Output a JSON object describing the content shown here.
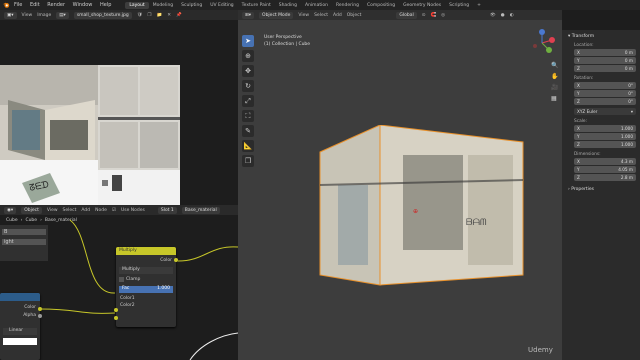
{
  "topbar": {
    "menus": [
      "File",
      "Edit",
      "Render",
      "Window",
      "Help"
    ],
    "workspaces": [
      "Layout",
      "Modeling",
      "Sculpting",
      "UV Editing",
      "Texture Paint",
      "Shading",
      "Animation",
      "Rendering",
      "Compositing",
      "Geometry Nodes",
      "Scripting"
    ],
    "active_workspace": "Layout"
  },
  "image_editor": {
    "menus": [
      "View",
      "Image"
    ],
    "filename": "small_shop_texture.jpg"
  },
  "node_editor": {
    "mode": "Object",
    "menus": [
      "View",
      "Select",
      "Add",
      "Node"
    ],
    "use_nodes_label": "Use Nodes",
    "slot": "Slot 1",
    "material": "Base_material",
    "breadcrumb_object": "Cube",
    "breadcrumb_mesh": "Cube",
    "breadcrumb_material": "Base_material",
    "left_panel_b": "B",
    "left_panel_ight": "ight",
    "multiply_node": {
      "title": "Multiply",
      "output": "Color",
      "blend_type": "Multiply",
      "clamp": "Clamp",
      "fac_label": "Fac",
      "fac_value": "1.000",
      "input1": "Color1",
      "input2": "Color2"
    },
    "image_node": {
      "output_color": "Color",
      "output_alpha": "Alpha",
      "interp": "Linear"
    }
  },
  "viewport": {
    "mode": "Object Mode",
    "menus": [
      "View",
      "Select",
      "Add",
      "Object"
    ],
    "transform_orientation": "Global",
    "view_name": "User Perspective",
    "collection_info": "(1) Collection | Cube"
  },
  "npanel": {
    "section_transform": "Transform",
    "location_label": "Location:",
    "location": [
      {
        "axis": "X",
        "value": "0 m"
      },
      {
        "axis": "Y",
        "value": "0 m"
      },
      {
        "axis": "Z",
        "value": "0 m"
      }
    ],
    "rotation_label": "Rotation:",
    "rotation": [
      {
        "axis": "X",
        "value": "0°"
      },
      {
        "axis": "Y",
        "value": "0°"
      },
      {
        "axis": "Z",
        "value": "0°"
      }
    ],
    "rotation_mode": "XYZ Euler",
    "scale_label": "Scale:",
    "scale": [
      {
        "axis": "X",
        "value": "1.000"
      },
      {
        "axis": "Y",
        "value": "1.000"
      },
      {
        "axis": "Z",
        "value": "1.000"
      }
    ],
    "dimensions_label": "Dimensions:",
    "dimensions": [
      {
        "axis": "X",
        "value": "4.3 m"
      },
      {
        "axis": "Y",
        "value": "4.05 m"
      },
      {
        "axis": "Z",
        "value": "2.8 m"
      }
    ],
    "section_properties": "Properties"
  },
  "watermark": "Udemy",
  "colors": {
    "selection_outline": "#e8902a",
    "active_tool": "#4772b3",
    "node_header_color": "#c7c729",
    "fac_field": "#4772b3"
  }
}
